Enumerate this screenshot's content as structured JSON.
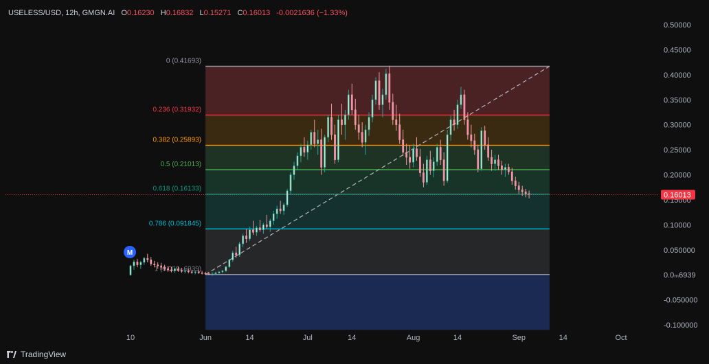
{
  "header": {
    "symbol": "USELESS/USD, 12h, GMGN.AI",
    "open_label": "O",
    "open": "0.16230",
    "high_label": "H",
    "high": "0.16832",
    "low_label": "L",
    "low": "0.15271",
    "close_label": "C",
    "close": "0.16013",
    "change": "-0.0021636 (−1.33%)"
  },
  "footer": {
    "brand": "TradingView",
    "brand_icon": "tradingview-logo-icon"
  },
  "marker": {
    "letter": "M",
    "color": "#2962ff"
  },
  "colors": {
    "background": "#0f0f0f",
    "up": "#26a69a",
    "down": "#ef9a9a",
    "up_candle": "#c8e6c9",
    "down_candle": "#f48fb1",
    "last_price": "#f23645"
  },
  "chart_data": {
    "type": "candlestick",
    "y_range": [
      -0.11,
      0.52
    ],
    "y_ticks": [
      "0.50000",
      "0.45000",
      "0.40000",
      "0.35000",
      "0.30000",
      "0.25000",
      "0.20000",
      "0.15000",
      "0.10000",
      "0.050000",
      "0.0ₘ6939",
      "-0.050000",
      "-0.100000"
    ],
    "y_tick_values": [
      0.5,
      0.45,
      0.4,
      0.35,
      0.3,
      0.25,
      0.2,
      0.15,
      0.1,
      0.05,
      0.0,
      -0.05,
      -0.1
    ],
    "x_ticks": [
      "10",
      "Jun",
      "14",
      "Jul",
      "14",
      "Aug",
      "14",
      "Sep",
      "14",
      "Oct"
    ],
    "x_tick_dates": [
      "2025-05-10",
      "2025-06-01",
      "2025-06-14",
      "2025-07-01",
      "2025-07-14",
      "2025-08-01",
      "2025-08-14",
      "2025-09-01",
      "2025-09-14",
      "2025-10-01"
    ],
    "last_price": 0.16013,
    "last_price_label": "0.16013",
    "fib": {
      "start_date": "2025-06-01",
      "end_date": "2025-09-10",
      "low": 0.00069,
      "high": 0.41693,
      "levels": [
        {
          "ratio": 0,
          "label": "0 (0.41693)",
          "value": 0.41693,
          "line": "#9598a1",
          "fill": "#4a2224",
          "text": "#9598a1"
        },
        {
          "ratio": 0.236,
          "label": "0.236 (0.31932)",
          "value": 0.31932,
          "line": "#f23645",
          "fill": "#3b2a12",
          "text": "#f23645"
        },
        {
          "ratio": 0.382,
          "label": "0.382 (0.25893)",
          "value": 0.25893,
          "line": "#ff9800",
          "fill": "#1f3324",
          "text": "#ff9800"
        },
        {
          "ratio": 0.5,
          "label": "0.5 (0.21013)",
          "value": 0.21013,
          "line": "#4caf50",
          "fill": "#183428",
          "text": "#4caf50"
        },
        {
          "ratio": 0.618,
          "label": "0.618 (0.16133)",
          "value": 0.16133,
          "line": "#089981",
          "fill": "#14302f",
          "text": "#089981"
        },
        {
          "ratio": 0.786,
          "label": "0.786 (0.091845)",
          "value": 0.091845,
          "line": "#00bcd4",
          "fill": "#262729",
          "text": "#00bcd4"
        },
        {
          "ratio": 1,
          "label": "1 (0.000ₘ6939)",
          "value": 0.00069,
          "line": "#9598a1",
          "fill": "#1a2a52",
          "text": "#787b86"
        }
      ],
      "extension_bottom": -0.11
    },
    "trend_line": {
      "from": [
        "2025-06-01",
        0.00069
      ],
      "to": [
        "2025-09-10",
        0.41693
      ]
    },
    "candles": [
      [
        "2025-05-10",
        0.0,
        0.02,
        -0.002,
        0.018
      ],
      [
        "2025-05-11",
        0.018,
        0.03,
        0.01,
        0.026
      ],
      [
        "2025-05-12",
        0.026,
        0.032,
        0.015,
        0.02
      ],
      [
        "2025-05-13",
        0.02,
        0.028,
        0.012,
        0.025
      ],
      [
        "2025-05-14",
        0.025,
        0.036,
        0.02,
        0.033
      ],
      [
        "2025-05-15",
        0.033,
        0.042,
        0.025,
        0.03
      ],
      [
        "2025-05-16",
        0.03,
        0.036,
        0.018,
        0.022
      ],
      [
        "2025-05-17",
        0.022,
        0.028,
        0.015,
        0.02
      ],
      [
        "2025-05-18",
        0.02,
        0.025,
        0.012,
        0.018
      ],
      [
        "2025-05-19",
        0.018,
        0.024,
        0.01,
        0.015
      ],
      [
        "2025-05-20",
        0.015,
        0.02,
        0.008,
        0.012
      ],
      [
        "2025-05-21",
        0.012,
        0.018,
        0.006,
        0.01
      ],
      [
        "2025-05-22",
        0.01,
        0.016,
        0.005,
        0.008
      ],
      [
        "2025-05-23",
        0.008,
        0.014,
        0.004,
        0.012
      ],
      [
        "2025-05-24",
        0.012,
        0.016,
        0.006,
        0.009
      ],
      [
        "2025-05-25",
        0.009,
        0.014,
        0.004,
        0.007
      ],
      [
        "2025-05-26",
        0.007,
        0.012,
        0.003,
        0.008
      ],
      [
        "2025-05-27",
        0.008,
        0.012,
        0.003,
        0.006
      ],
      [
        "2025-05-28",
        0.006,
        0.01,
        0.002,
        0.005
      ],
      [
        "2025-05-29",
        0.005,
        0.009,
        0.001,
        0.006
      ],
      [
        "2025-05-30",
        0.006,
        0.01,
        0.002,
        0.004
      ],
      [
        "2025-05-31",
        0.004,
        0.008,
        0.001,
        0.003
      ],
      [
        "2025-06-01",
        0.003,
        0.006,
        0.0,
        0.002
      ],
      [
        "2025-06-02",
        0.002,
        0.005,
        0.0,
        0.001
      ],
      [
        "2025-06-03",
        0.001,
        0.005,
        -0.002,
        0.002
      ],
      [
        "2025-06-04",
        0.002,
        0.006,
        0.0,
        0.004
      ],
      [
        "2025-06-05",
        0.004,
        0.008,
        0.002,
        0.006
      ],
      [
        "2025-06-06",
        0.006,
        0.01,
        0.003,
        0.008
      ],
      [
        "2025-06-07",
        0.008,
        0.018,
        0.006,
        0.016
      ],
      [
        "2025-06-08",
        0.016,
        0.032,
        0.014,
        0.03
      ],
      [
        "2025-06-09",
        0.03,
        0.048,
        0.026,
        0.044
      ],
      [
        "2025-06-10",
        0.044,
        0.056,
        0.034,
        0.04
      ],
      [
        "2025-06-11",
        0.04,
        0.066,
        0.036,
        0.062
      ],
      [
        "2025-06-12",
        0.062,
        0.082,
        0.055,
        0.078
      ],
      [
        "2025-06-13",
        0.078,
        0.092,
        0.064,
        0.072
      ],
      [
        "2025-06-14",
        0.072,
        0.096,
        0.068,
        0.09
      ],
      [
        "2025-06-15",
        0.09,
        0.108,
        0.08,
        0.085
      ],
      [
        "2025-06-16",
        0.085,
        0.098,
        0.078,
        0.094
      ],
      [
        "2025-06-17",
        0.094,
        0.11,
        0.086,
        0.09
      ],
      [
        "2025-06-18",
        0.09,
        0.104,
        0.082,
        0.1
      ],
      [
        "2025-06-19",
        0.1,
        0.12,
        0.092,
        0.096
      ],
      [
        "2025-06-20",
        0.096,
        0.112,
        0.086,
        0.108
      ],
      [
        "2025-06-21",
        0.108,
        0.128,
        0.1,
        0.122
      ],
      [
        "2025-06-22",
        0.122,
        0.138,
        0.112,
        0.132
      ],
      [
        "2025-06-23",
        0.132,
        0.148,
        0.122,
        0.128
      ],
      [
        "2025-06-24",
        0.128,
        0.144,
        0.12,
        0.14
      ],
      [
        "2025-06-25",
        0.14,
        0.172,
        0.136,
        0.168
      ],
      [
        "2025-06-26",
        0.168,
        0.205,
        0.16,
        0.2
      ],
      [
        "2025-06-27",
        0.2,
        0.226,
        0.19,
        0.218
      ],
      [
        "2025-06-28",
        0.218,
        0.245,
        0.21,
        0.238
      ],
      [
        "2025-06-29",
        0.238,
        0.262,
        0.225,
        0.255
      ],
      [
        "2025-06-30",
        0.255,
        0.275,
        0.236,
        0.245
      ],
      [
        "2025-07-01",
        0.245,
        0.268,
        0.23,
        0.26
      ],
      [
        "2025-07-02",
        0.26,
        0.29,
        0.25,
        0.285
      ],
      [
        "2025-07-03",
        0.285,
        0.31,
        0.255,
        0.262
      ],
      [
        "2025-07-04",
        0.262,
        0.29,
        0.24,
        0.27
      ],
      [
        "2025-07-05",
        0.27,
        0.292,
        0.2,
        0.215
      ],
      [
        "2025-07-06",
        0.215,
        0.28,
        0.205,
        0.275
      ],
      [
        "2025-07-07",
        0.275,
        0.32,
        0.265,
        0.315
      ],
      [
        "2025-07-08",
        0.315,
        0.342,
        0.27,
        0.28
      ],
      [
        "2025-07-09",
        0.28,
        0.3,
        0.222,
        0.23
      ],
      [
        "2025-07-10",
        0.23,
        0.32,
        0.225,
        0.31
      ],
      [
        "2025-07-11",
        0.31,
        0.342,
        0.28,
        0.3
      ],
      [
        "2025-07-12",
        0.3,
        0.33,
        0.27,
        0.32
      ],
      [
        "2025-07-13",
        0.32,
        0.37,
        0.31,
        0.36
      ],
      [
        "2025-07-14",
        0.36,
        0.382,
        0.32,
        0.33
      ],
      [
        "2025-07-15",
        0.33,
        0.352,
        0.29,
        0.3
      ],
      [
        "2025-07-16",
        0.3,
        0.32,
        0.27,
        0.285
      ],
      [
        "2025-07-17",
        0.285,
        0.305,
        0.255,
        0.265
      ],
      [
        "2025-07-18",
        0.265,
        0.3,
        0.24,
        0.29
      ],
      [
        "2025-07-19",
        0.29,
        0.325,
        0.278,
        0.315
      ],
      [
        "2025-07-20",
        0.315,
        0.36,
        0.305,
        0.35
      ],
      [
        "2025-07-21",
        0.35,
        0.395,
        0.34,
        0.388
      ],
      [
        "2025-07-22",
        0.388,
        0.405,
        0.33,
        0.34
      ],
      [
        "2025-07-23",
        0.34,
        0.372,
        0.315,
        0.36
      ],
      [
        "2025-07-24",
        0.36,
        0.412,
        0.35,
        0.402
      ],
      [
        "2025-07-25",
        0.402,
        0.418,
        0.33,
        0.345
      ],
      [
        "2025-07-26",
        0.345,
        0.362,
        0.3,
        0.31
      ],
      [
        "2025-07-27",
        0.31,
        0.34,
        0.288,
        0.3
      ],
      [
        "2025-07-28",
        0.3,
        0.322,
        0.262,
        0.27
      ],
      [
        "2025-07-29",
        0.27,
        0.29,
        0.238,
        0.245
      ],
      [
        "2025-07-30",
        0.245,
        0.262,
        0.22,
        0.235
      ],
      [
        "2025-07-31",
        0.235,
        0.258,
        0.212,
        0.225
      ],
      [
        "2025-08-01",
        0.225,
        0.262,
        0.215,
        0.252
      ],
      [
        "2025-08-02",
        0.252,
        0.275,
        0.228,
        0.236
      ],
      [
        "2025-08-03",
        0.236,
        0.252,
        0.196,
        0.204
      ],
      [
        "2025-08-04",
        0.204,
        0.222,
        0.175,
        0.185
      ],
      [
        "2025-08-05",
        0.185,
        0.238,
        0.18,
        0.23
      ],
      [
        "2025-08-06",
        0.23,
        0.248,
        0.2,
        0.208
      ],
      [
        "2025-08-07",
        0.208,
        0.235,
        0.195,
        0.226
      ],
      [
        "2025-08-08",
        0.226,
        0.262,
        0.218,
        0.255
      ],
      [
        "2025-08-09",
        0.255,
        0.27,
        0.22,
        0.23
      ],
      [
        "2025-08-10",
        0.23,
        0.245,
        0.178,
        0.188
      ],
      [
        "2025-08-11",
        0.188,
        0.29,
        0.184,
        0.28
      ],
      [
        "2025-08-12",
        0.28,
        0.318,
        0.268,
        0.31
      ],
      [
        "2025-08-13",
        0.31,
        0.33,
        0.288,
        0.3
      ],
      [
        "2025-08-14",
        0.3,
        0.35,
        0.292,
        0.34
      ],
      [
        "2025-08-15",
        0.34,
        0.376,
        0.332,
        0.36
      ],
      [
        "2025-08-16",
        0.36,
        0.37,
        0.3,
        0.31
      ],
      [
        "2025-08-17",
        0.31,
        0.325,
        0.27,
        0.28
      ],
      [
        "2025-08-18",
        0.28,
        0.3,
        0.255,
        0.268
      ],
      [
        "2025-08-19",
        0.268,
        0.282,
        0.24,
        0.25
      ],
      [
        "2025-08-20",
        0.25,
        0.26,
        0.205,
        0.212
      ],
      [
        "2025-08-21",
        0.212,
        0.295,
        0.208,
        0.288
      ],
      [
        "2025-08-22",
        0.288,
        0.298,
        0.25,
        0.26
      ],
      [
        "2025-08-23",
        0.26,
        0.275,
        0.228,
        0.235
      ],
      [
        "2025-08-24",
        0.235,
        0.25,
        0.208,
        0.222
      ],
      [
        "2025-08-25",
        0.222,
        0.24,
        0.208,
        0.23
      ],
      [
        "2025-08-26",
        0.23,
        0.24,
        0.21,
        0.218
      ],
      [
        "2025-08-27",
        0.218,
        0.228,
        0.2,
        0.21
      ],
      [
        "2025-08-28",
        0.21,
        0.222,
        0.196,
        0.215
      ],
      [
        "2025-08-29",
        0.215,
        0.222,
        0.2,
        0.206
      ],
      [
        "2025-08-30",
        0.206,
        0.214,
        0.18,
        0.188
      ],
      [
        "2025-08-31",
        0.188,
        0.196,
        0.17,
        0.178
      ],
      [
        "2025-09-01",
        0.178,
        0.186,
        0.162,
        0.17
      ],
      [
        "2025-09-02",
        0.17,
        0.178,
        0.158,
        0.166
      ],
      [
        "2025-09-03",
        0.166,
        0.172,
        0.155,
        0.162
      ],
      [
        "2025-09-04",
        0.1623,
        0.16832,
        0.15271,
        0.16013
      ]
    ]
  }
}
